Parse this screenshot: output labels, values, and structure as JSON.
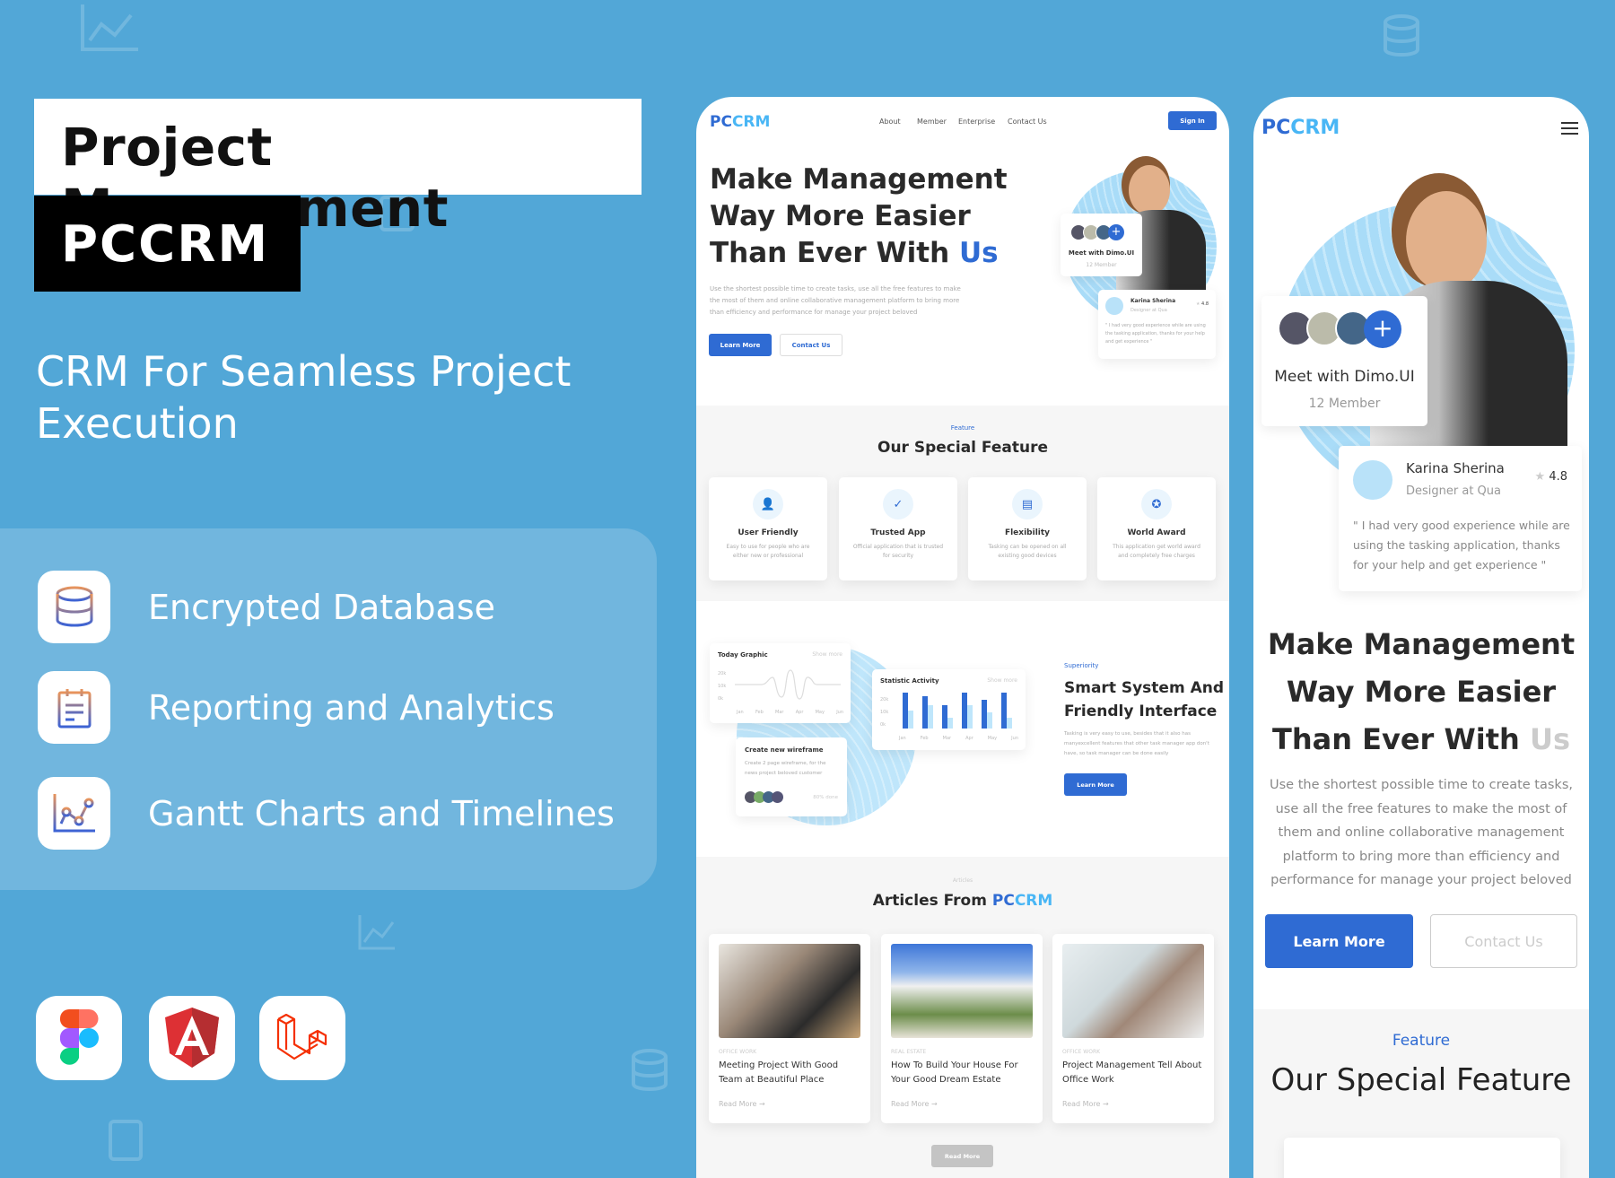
{
  "promo": {
    "title": "Project Management",
    "brand": "PCCRM",
    "subtitle": "CRM For Seamless Project Execution",
    "features": [
      {
        "icon": "database-icon",
        "label": "Encrypted Database"
      },
      {
        "icon": "clipboard-report-icon",
        "label": "Reporting and Analytics"
      },
      {
        "icon": "line-chart-icon",
        "label": "Gantt Charts and Timelines"
      }
    ],
    "tech_logos": [
      "figma-logo",
      "angular-logo",
      "laravel-logo"
    ]
  },
  "colors": {
    "background": "#52a7d7",
    "primary": "#2f6bd3",
    "accent": "#49b6f5",
    "text": "#2a2a2a"
  },
  "desktop": {
    "logo": {
      "part1": "PC",
      "part2": "CRM"
    },
    "nav": [
      "About",
      "Member",
      "Enterprise",
      "Contact Us"
    ],
    "sign_in": "Sign In",
    "hero": {
      "heading_line1": "Make Management",
      "heading_line2": "Way More Easier",
      "heading_line3": "Than Ever With ",
      "heading_highlight": "Us",
      "paragraph": "Use the shortest possible time to create tasks, use all the free features to make the most of them and online collaborative management platform to bring more than efficiency and performance for manage your project beloved",
      "learn_more": "Learn More",
      "contact_us": "Contact Us",
      "meet_card": {
        "title": "Meet with Dimo.UI",
        "sub": "12 Member"
      },
      "review": {
        "name": "Karina Sherina",
        "role": "Designer at Qua",
        "rating": "4.8",
        "quote": "\" I had very good experience while are using the tasking application, thanks for your help and get experience \""
      }
    },
    "feature": {
      "eyebrow": "Feature",
      "title": "Our Special Feature",
      "cards": [
        {
          "icon": "users-icon",
          "title": "User Friendly",
          "desc": "Easy to use for people who are either new or professional"
        },
        {
          "icon": "check-circle-icon",
          "title": "Trusted App",
          "desc": "Official application that is trusted for security"
        },
        {
          "icon": "document-icon",
          "title": "Flexibility",
          "desc": "Tasking can be opened on all existing good devices"
        },
        {
          "icon": "award-icon",
          "title": "World Award",
          "desc": "This application get world award and completely free charges"
        }
      ]
    },
    "superiority": {
      "today_graphic": {
        "title": "Today Graphic",
        "show_more": "Show more",
        "y_ticks": [
          "20k",
          "10k",
          "0k"
        ],
        "months": [
          "Jan",
          "Feb",
          "Mar",
          "Apr",
          "May",
          "Jun"
        ]
      },
      "statistic": {
        "title": "Statistic Activity",
        "show_more": "Show more",
        "y_ticks": [
          "20k",
          "10k",
          "0k"
        ],
        "months": [
          "Jan",
          "Feb",
          "Mar",
          "Apr",
          "May",
          "Jun"
        ],
        "dark": [
          20,
          18,
          13,
          20,
          16,
          20
        ],
        "light": [
          10,
          13,
          6,
          13,
          9,
          6
        ]
      },
      "wireframe": {
        "title": "Create new wireframe",
        "desc": "Create 2 page wireframe, for the news project beloved customer",
        "progress": "80% done"
      },
      "eyebrow": "Superiority",
      "title_line1": "Smart System And",
      "title_line2": "Friendly Interface",
      "paragraph": "Tasking is very easy to use, besides that it also has manyexcellent features that other task manager app don't have, so task manager can be done easily",
      "learn_more": "Learn More"
    },
    "articles": {
      "eyebrow": "Articles",
      "title": "Articles From ",
      "title_brand1": "PC",
      "title_brand2": "CRM",
      "items": [
        {
          "category": "OFFICE WORK",
          "title": "Meeting Project With Good Team at Beautiful Place",
          "read": "Read More →"
        },
        {
          "category": "REAL ESTATE",
          "title": "How To Build Your House For Your Good Dream Estate",
          "read": "Read More →"
        },
        {
          "category": "OFFICE WORK",
          "title": "Project Management Tell About Office Work",
          "read": "Read More →"
        }
      ],
      "read_more": "Read More"
    }
  },
  "mobile": {
    "logo": {
      "part1": "PC",
      "part2": "CRM"
    },
    "meet_card": {
      "title": "Meet with Dimo.UI",
      "sub": "12 Member"
    },
    "review": {
      "name": "Karina Sherina",
      "role": "Designer at Qua",
      "rating": "4.8",
      "quote": "\" I had very good experience while are using the tasking application, thanks for your help and get experience \""
    },
    "heading_line1": "Make Management",
    "heading_line2": "Way More Easier",
    "heading_line3": "Than Ever With ",
    "heading_highlight": "Us",
    "paragraph": "Use the shortest possible time to create tasks, use all the free features to make the most of them and online collaborative management platform to bring more than efficiency and performance for manage your project beloved",
    "learn_more": "Learn More",
    "contact_us": "Contact Us",
    "feature_eyebrow": "Feature",
    "feature_title": "Our Special Feature"
  }
}
